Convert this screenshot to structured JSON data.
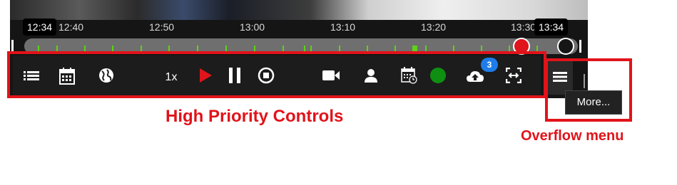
{
  "timeline": {
    "current_time": "12:34",
    "end_time": "13:34",
    "ticks": [
      "12:40",
      "12:50",
      "13:00",
      "13:10",
      "13:20",
      "13:30"
    ]
  },
  "controls": {
    "speed_label": "1x",
    "upload_count": "3"
  },
  "annotations": {
    "high_priority": "High Priority Controls",
    "overflow": "Overflow menu"
  },
  "overflow": {
    "tooltip": "More..."
  },
  "colors": {
    "annotation_red": "#e1131a",
    "play_red": "#e0141b",
    "timeline_green": "#5fd11a",
    "status_green": "#0f8f12",
    "badge_blue": "#1f7dea"
  },
  "icons": [
    "list-icon",
    "calendar-icon",
    "globe-icon",
    "play-icon",
    "pause-icon",
    "stop-icon",
    "camera-icon",
    "user-icon",
    "schedule-icon",
    "status-dot",
    "cloud-upload-icon",
    "expand-icon",
    "menu-icon"
  ]
}
